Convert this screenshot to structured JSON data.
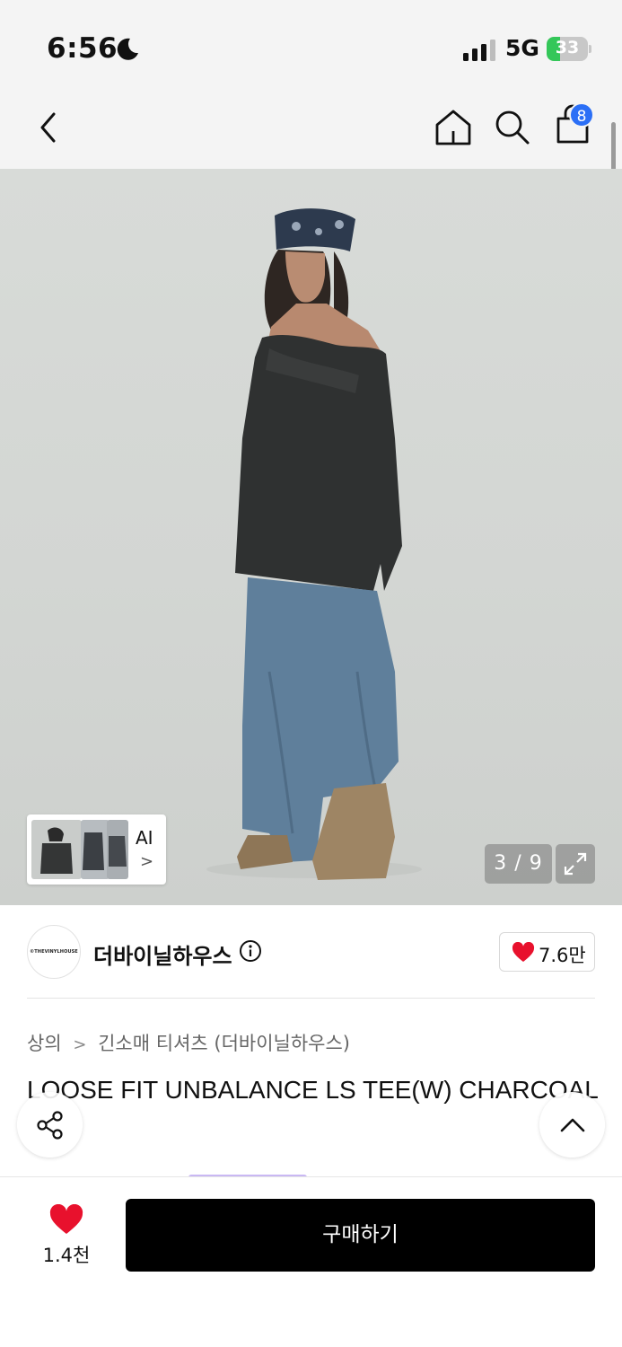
{
  "status_bar": {
    "time": "6:56",
    "network": "5G",
    "battery_level": "33",
    "battery_fraction": 0.33,
    "battery_color": "#34c759"
  },
  "nav": {
    "back_icon": "chevron-left-icon",
    "home_icon": "home-icon",
    "search_icon": "search-icon",
    "cart_icon": "shopping-bag-icon",
    "cart_count": "8",
    "badge_color": "#2b6ff6"
  },
  "gallery": {
    "ai_label": "AI",
    "ai_chevron": ">",
    "page_counter": "3 / 9",
    "expand_icon": "expand-icon"
  },
  "brand": {
    "logo_text": "©THEVINYLHOUSE",
    "name": "더바이닐하우스",
    "info_icon": "info-icon",
    "like_count": "7.6만",
    "heart_color": "#e8112d"
  },
  "product": {
    "breadcrumb": [
      "상의",
      "긴소매 티셔츠 (더바이닐하우스)"
    ],
    "breadcrumb_separator": ">",
    "title": "LOOSE FIT UNBALANCE LS TEE(W) CHARCOAL"
  },
  "floating": {
    "share_icon": "share-icon",
    "top_icon": "chevron-up-icon"
  },
  "bottom_bar": {
    "wish_count": "1.4천",
    "buy_label": "구매하기"
  }
}
